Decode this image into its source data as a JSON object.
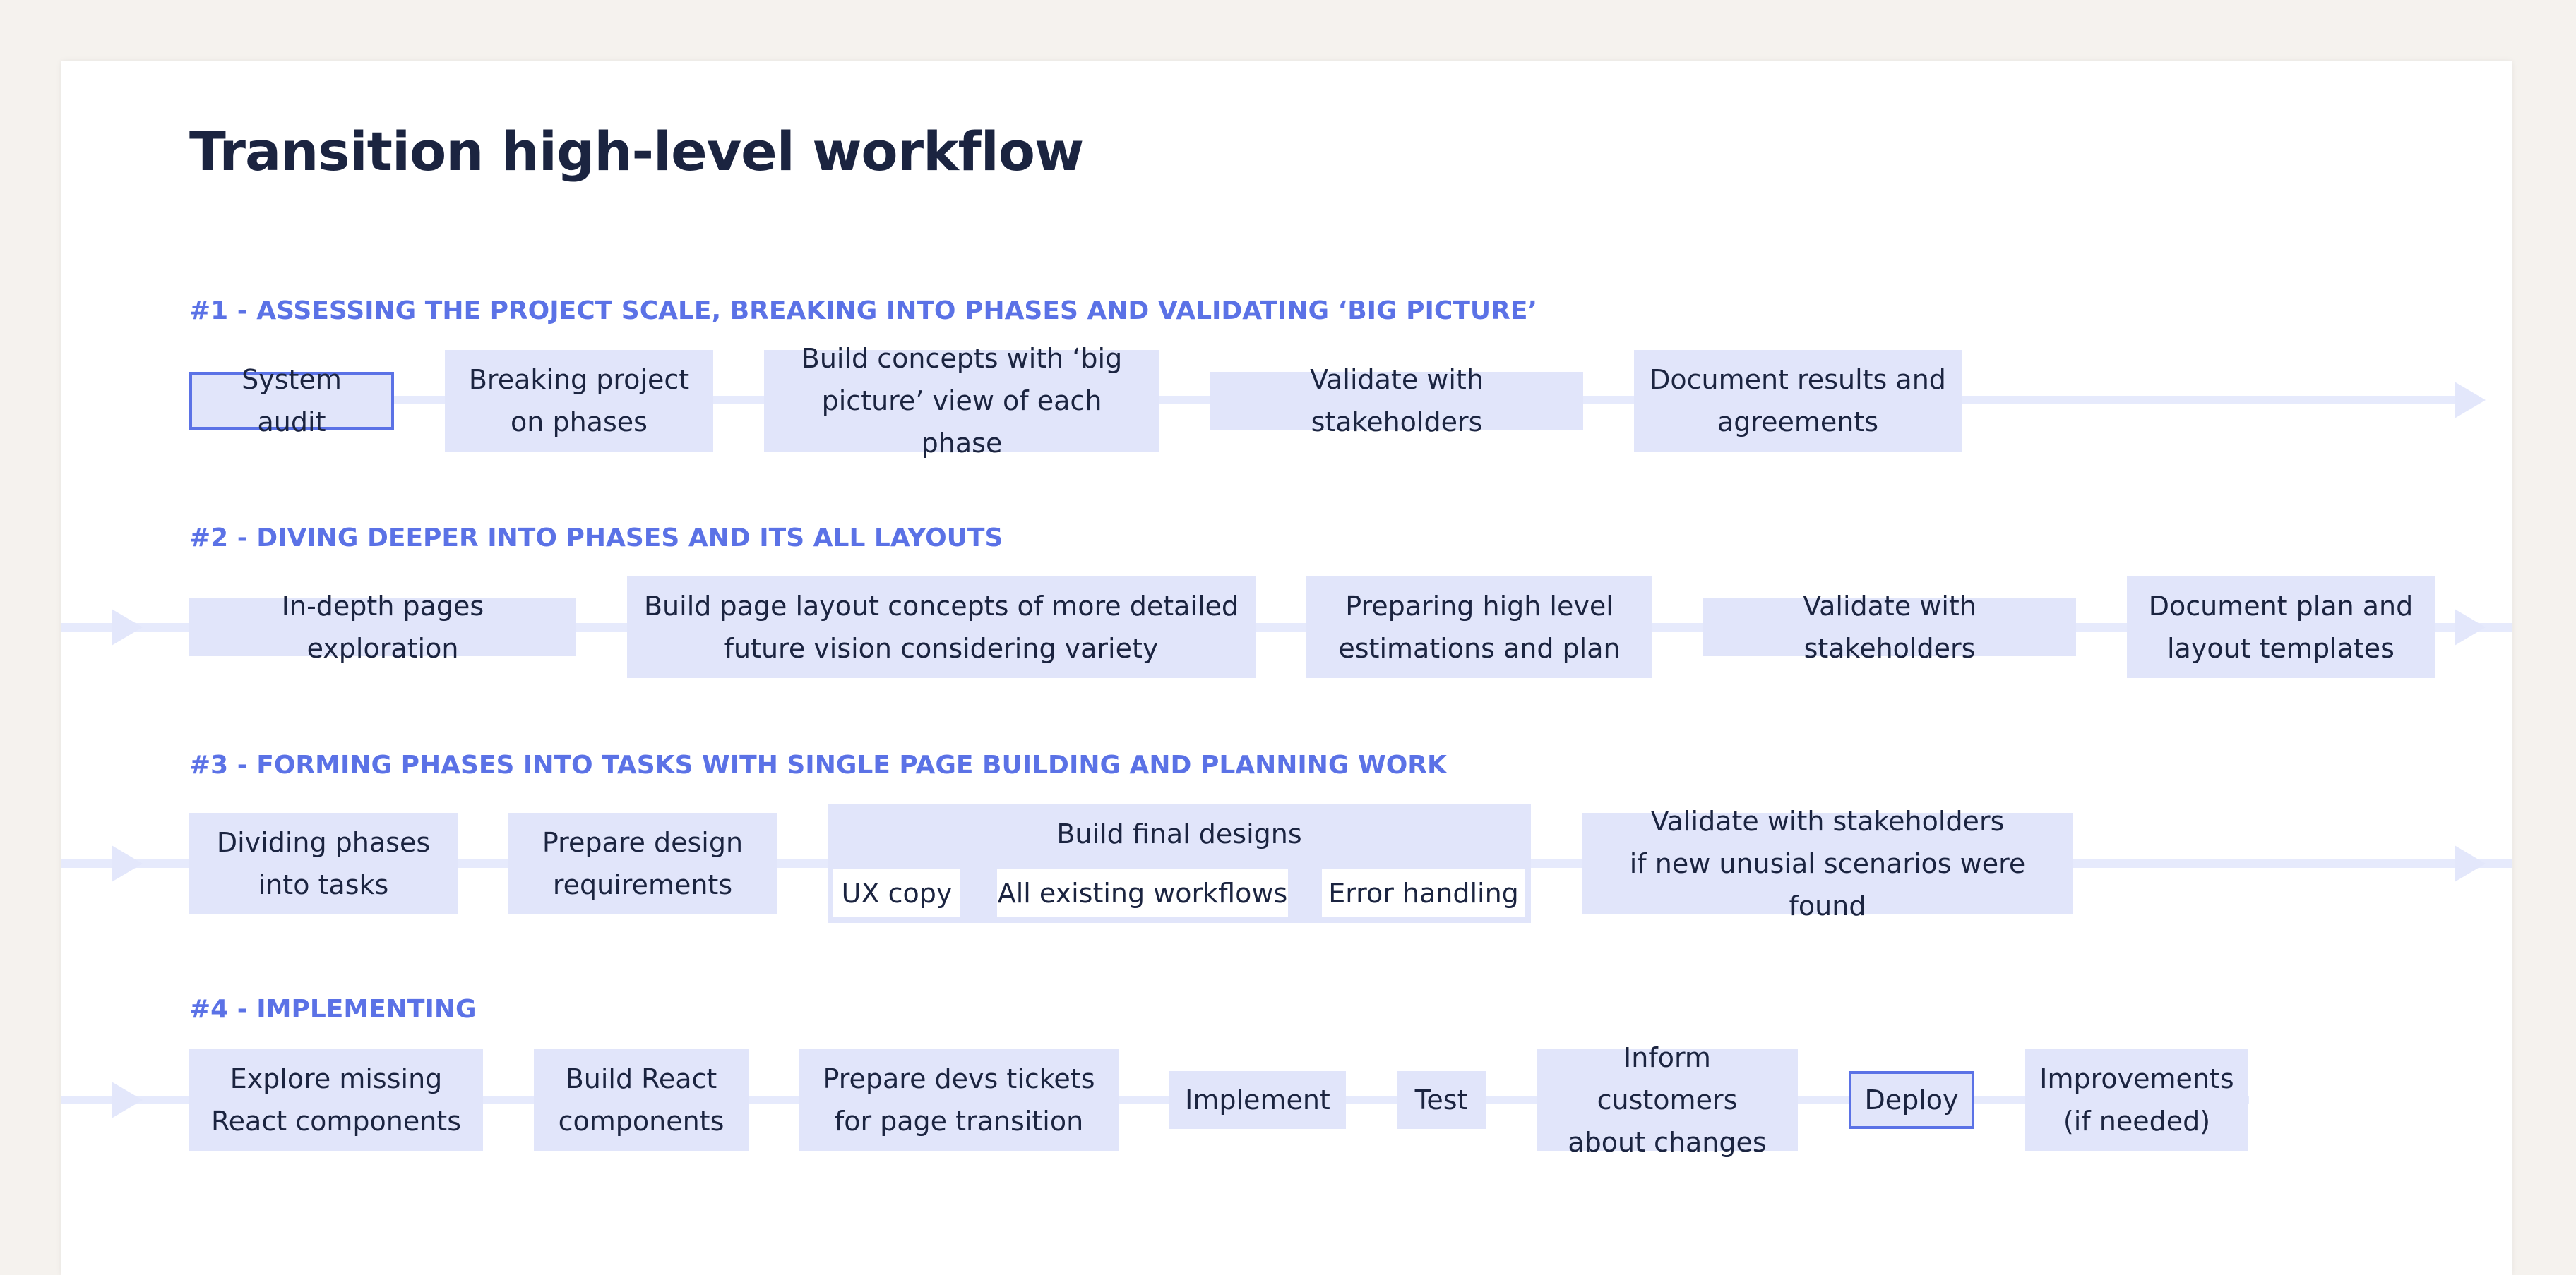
{
  "title": "Transition high-level workflow",
  "sections": [
    {
      "heading": "#1 - ASSESSING THE PROJECT SCALE, BREAKING INTO PHASES AND VALIDATING ‘BIG PICTURE’",
      "steps": [
        "System audit",
        "Breaking project\non phases",
        "Build concepts with ‘big\npicture’ view of each phase",
        "Validate with stakeholders",
        "Document results and\nagreements"
      ]
    },
    {
      "heading": "#2 - DIVING DEEPER INTO PHASES AND ITS ALL LAYOUTS",
      "steps": [
        "In-depth pages exploration",
        "Build page layout concepts of more detailed\nfuture vision considering variety",
        "Preparing high level\nestimations and plan",
        "Validate with stakeholders",
        "Document plan and\nlayout templates"
      ]
    },
    {
      "heading": "#3 - FORMING PHASES INTO TASKS WITH SINGLE PAGE BUILDING AND PLANNING WORK",
      "steps": [
        "Dividing phases\ninto tasks",
        "Prepare design\nrequirements"
      ],
      "group": {
        "label": "Build final designs",
        "items": [
          "UX copy",
          "All existing workflows",
          "Error handling"
        ]
      },
      "final_step": "Validate with stakeholders\nif new unusial scenarios were found"
    },
    {
      "heading": "#4 - IMPLEMENTING",
      "steps": [
        "Explore missing\nReact components",
        "Build React\ncomponents",
        "Prepare devs tickets\nfor page transition",
        "Implement",
        "Test",
        "Inform customers\nabout changes",
        "Deploy",
        "Improvements\n(if needed)"
      ]
    }
  ],
  "colors": {
    "accent": "#5b72e6",
    "box_fill": "#e1e5fa",
    "title": "#1b2440",
    "background": "#f5f2ee"
  }
}
